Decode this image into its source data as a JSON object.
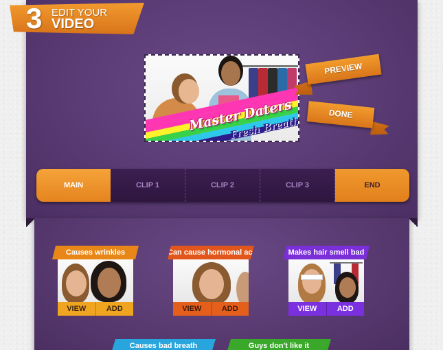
{
  "header": {
    "step_number": "3",
    "title_line1": "EDIT YOUR",
    "title_line2": "VIDEO"
  },
  "preview": {
    "title": "Master Daters",
    "subtitle": "Fresh Breath",
    "rainbow_colors": [
      "#ff36b4",
      "#ff36b4",
      "#fff12a",
      "#38d14a",
      "#2ec8ea",
      "#2d1d8a"
    ]
  },
  "actions": {
    "preview_label": "PREVIEW",
    "done_label": "DONE"
  },
  "timeline": {
    "main_label": "MAIN",
    "clips": [
      "CLIP 1",
      "CLIP 2",
      "CLIP 3"
    ],
    "end_label": "END"
  },
  "clips": [
    {
      "title": "Causes wrinkles",
      "color": "#e88718",
      "view_label": "VIEW",
      "add_label": "ADD",
      "button_color": "#f0a520",
      "text_color": "#3a2410"
    },
    {
      "title": "Can cause hormonal acne",
      "color": "#e1561a",
      "view_label": "VIEW",
      "add_label": "ADD",
      "button_color": "#e55f1c",
      "text_color": "#3a1a0a"
    },
    {
      "title": "Makes hair smell bad",
      "color": "#7a2fd8",
      "view_label": "VIEW",
      "add_label": "ADD",
      "button_color": "#7b30e0",
      "text_color": "#ffffff"
    },
    {
      "title": "Causes bad breath",
      "color": "#28a5dc"
    },
    {
      "title": "Guys don't like it",
      "color": "#3aa82a"
    }
  ],
  "colors": {
    "accent_orange": "#e9891f",
    "panel_purple": "#5a3b74",
    "timeline_dark": "#2e163f"
  }
}
